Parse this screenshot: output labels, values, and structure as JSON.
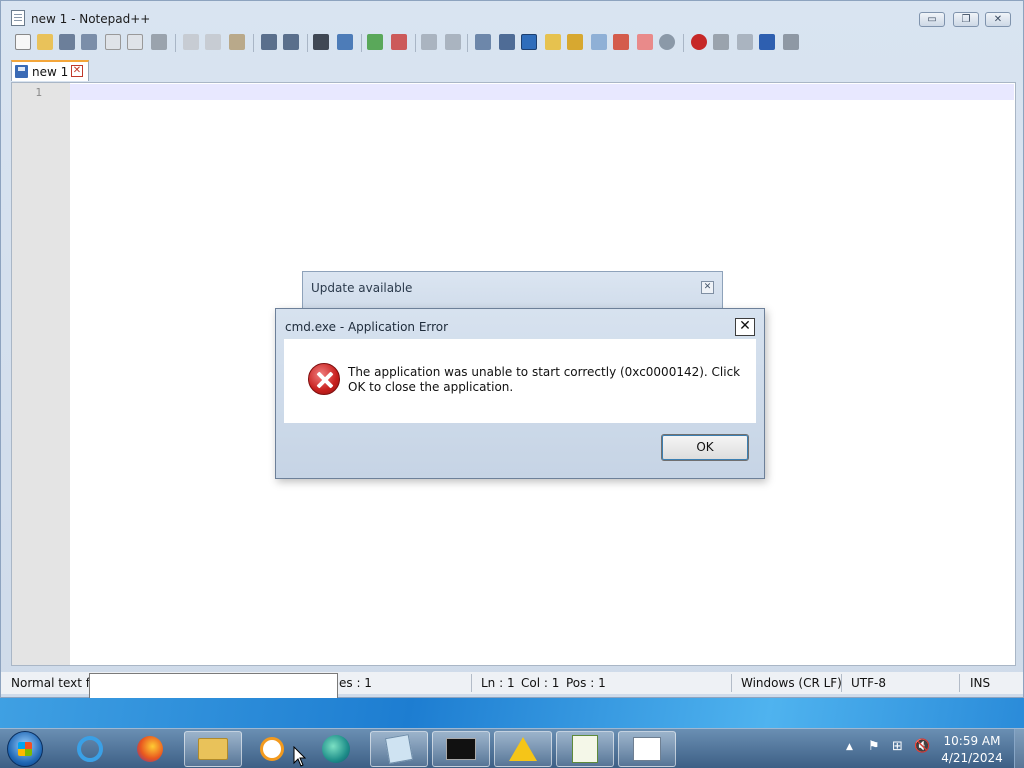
{
  "window": {
    "title": "new 1 - Notepad++",
    "controls": {
      "minimize": "▭",
      "maximize": "❐",
      "close": "✕"
    }
  },
  "toolbar": {
    "icons": [
      "new-file",
      "open-file",
      "save",
      "save-all",
      "close",
      "close-all",
      "print",
      "cut",
      "copy",
      "paste",
      "undo",
      "redo",
      "find",
      "replace",
      "zoom-in",
      "zoom-out",
      "sync-vertical",
      "sync-horizontal",
      "word-wrap",
      "show-all-chars",
      "indent-guide",
      "doc-map",
      "function-list",
      "folder-as-workspace",
      "monitoring",
      "user-defined-lang",
      "record-macro",
      "stop-record",
      "play-macro",
      "run-macro-multiple",
      "save-macro"
    ]
  },
  "tabs": [
    {
      "label": "new 1",
      "close": "✕"
    }
  ],
  "editor": {
    "line_numbers": [
      "1"
    ]
  },
  "statusbar": {
    "file_type": "Normal text file",
    "lines": "es : 1",
    "ln": "Ln : 1",
    "col": "Col : 1",
    "pos": "Pos : 1",
    "eol": "Windows (CR LF)",
    "encoding": "UTF-8",
    "mode": "INS"
  },
  "update_dialog": {
    "title": "Update available",
    "close": "✕"
  },
  "error_dialog": {
    "title": "cmd.exe - Application Error",
    "close": "✕",
    "message": "The application was unable to start correctly (0xc0000142). Click OK to close the application.",
    "ok_label": "OK"
  },
  "taskbar": {
    "apps": [
      "internet-explorer",
      "firefox",
      "file-explorer",
      "media-player",
      "edge",
      "notepad",
      "command-prompt",
      "warning",
      "notepad-plus-plus",
      "document-viewer"
    ],
    "clock": {
      "time": "10:59 AM",
      "date": "4/21/2024"
    },
    "tray": {
      "arrow": "▲",
      "flag": "⚑",
      "network": "⊞",
      "volume": "🔇"
    }
  },
  "colors": {
    "accent": "#3c7fb1",
    "error_red": "#c8201e",
    "tab_highlight": "#f4a63a",
    "current_line": "#e8e8ff"
  }
}
